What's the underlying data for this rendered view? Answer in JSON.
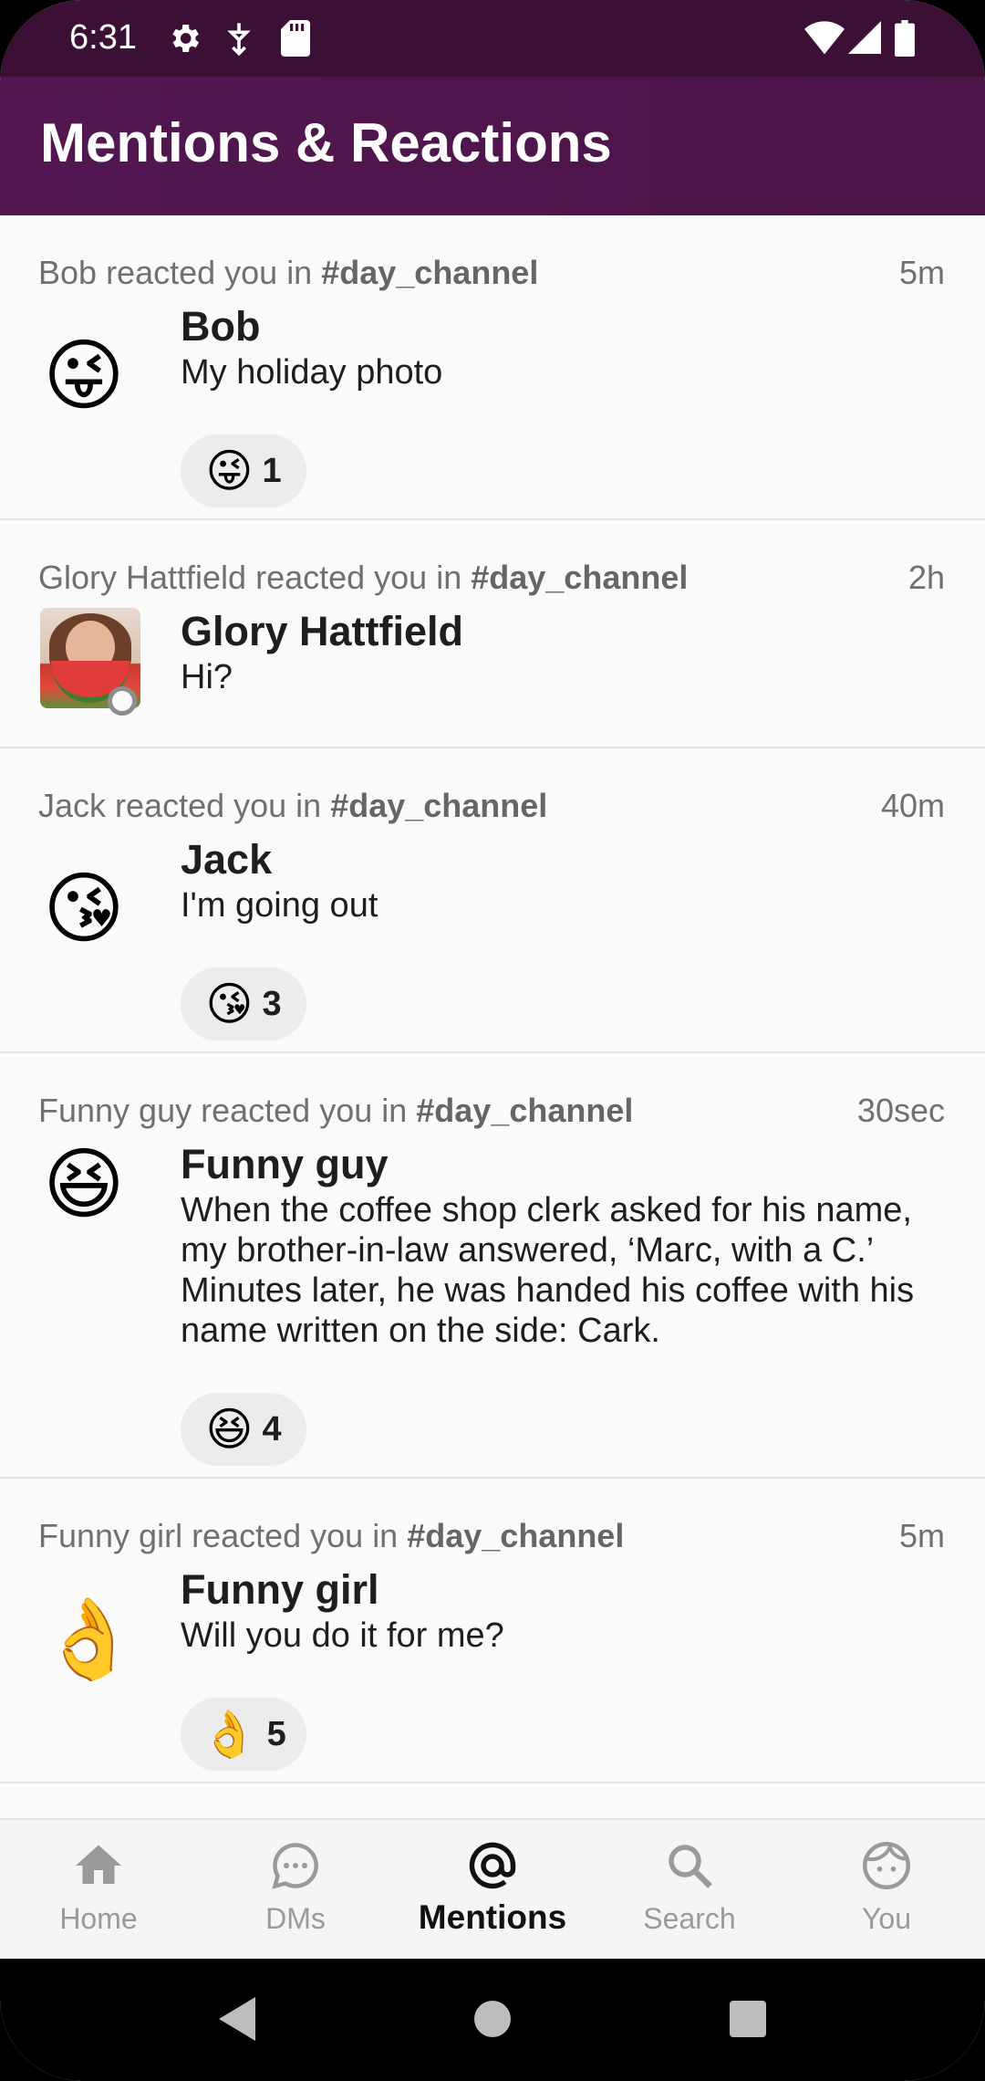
{
  "status_bar": {
    "time": "6:31"
  },
  "app_bar": {
    "title": "Mentions & Reactions"
  },
  "feed": [
    {
      "actor": "Bob",
      "channel": "#day_channel",
      "time": "5m",
      "avatar_emoji": "😜",
      "name": "Bob",
      "message": "My holiday photo",
      "reaction": {
        "emoji": "😜",
        "count": "1"
      }
    },
    {
      "actor": "Glory Hattfield",
      "channel": "#day_channel",
      "time": "2h",
      "avatar_emoji": "",
      "name": "Glory Hattfield",
      "message": "Hi?"
    },
    {
      "actor": "Jack",
      "channel": "#day_channel",
      "time": "40m",
      "avatar_emoji": "😘",
      "name": "Jack",
      "message": "I'm going out",
      "reaction": {
        "emoji": "😘",
        "count": "3"
      }
    },
    {
      "actor": "Funny guy",
      "channel": "#day_channel",
      "time": "30sec",
      "avatar_emoji": "😆",
      "name": "Funny guy",
      "message": "When the coffee shop clerk asked for his name, my brother-in-law answered, ‘Marc, with a C.’ Minutes later, he was handed his coffee with his name written on the side: Cark.",
      "reaction": {
        "emoji": "😆",
        "count": "4"
      }
    },
    {
      "actor": "Funny girl",
      "channel": "#day_channel",
      "time": "5m",
      "avatar_emoji": "👌",
      "name": "Funny girl",
      "message": "Will you do it for me?",
      "reaction": {
        "emoji": "👌",
        "count": "5"
      }
    }
  ],
  "reacted_text": " reacted you in ",
  "bottom_nav": {
    "home": "Home",
    "dms": "DMs",
    "mentions": "Mentions",
    "search": "Search",
    "you": "You",
    "active": "mentions"
  },
  "colors": {
    "status_bar": "#3b1034",
    "app_bar": "#521751",
    "background": "#fafafa"
  }
}
